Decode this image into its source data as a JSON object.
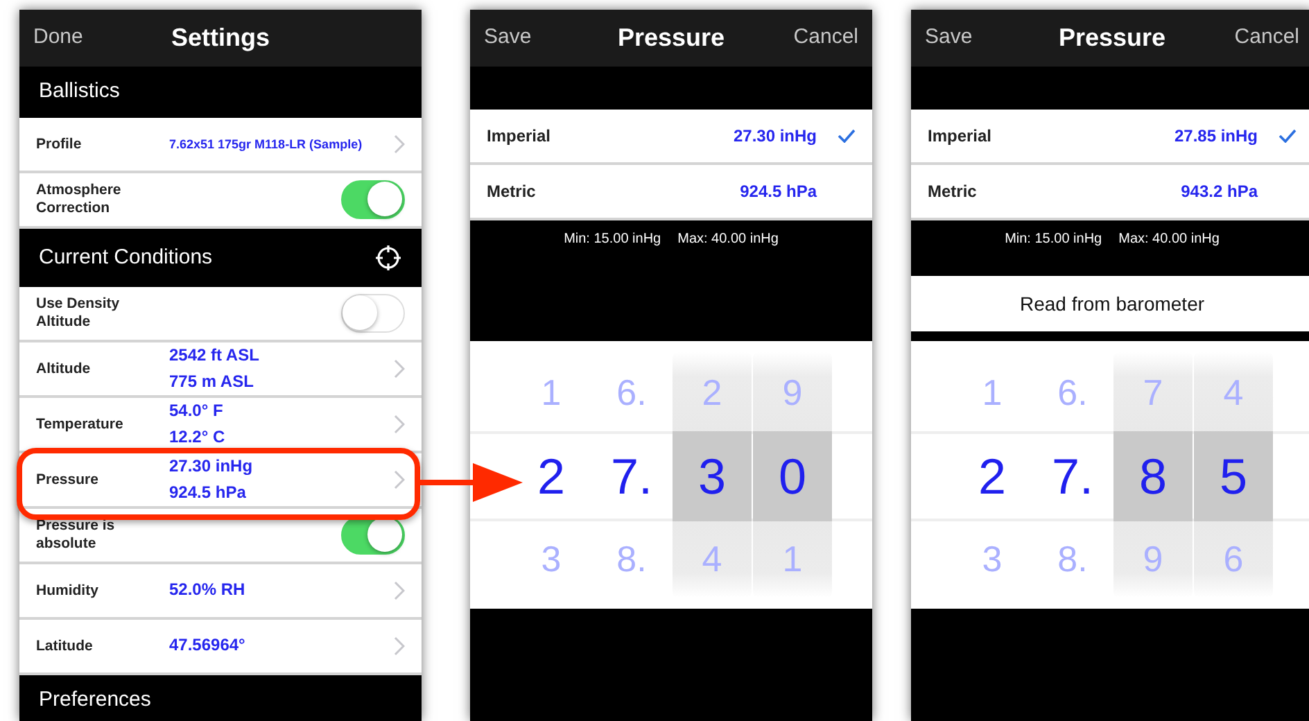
{
  "screens": [
    {
      "kind": "settings",
      "nav": {
        "left": "Done",
        "title": "Settings"
      },
      "sections": [
        {
          "title": "Ballistics",
          "target_icon": false,
          "rows": [
            {
              "kind": "value",
              "label": "Profile",
              "values": [
                "7.62x51 175gr M118-LR (Sample)"
              ],
              "small": true
            },
            {
              "kind": "switch",
              "label": "Atmosphere Correction",
              "on": true
            }
          ]
        },
        {
          "title": "Current Conditions",
          "target_icon": true,
          "rows": [
            {
              "kind": "switch",
              "label": "Use Density Altitude",
              "on": false
            },
            {
              "kind": "value",
              "label": "Altitude",
              "values": [
                "2542 ft ASL",
                "775 m ASL"
              ]
            },
            {
              "kind": "value",
              "label": "Temperature",
              "values": [
                "54.0° F",
                "12.2° C"
              ]
            },
            {
              "kind": "value",
              "label": "Pressure",
              "values": [
                "27.30 inHg",
                "924.5 hPa"
              ]
            },
            {
              "kind": "switch",
              "label": "Pressure is absolute",
              "on": true
            },
            {
              "kind": "value",
              "label": "Humidity",
              "values": [
                "52.0% RH"
              ]
            },
            {
              "kind": "value",
              "label": "Latitude",
              "values": [
                "47.56964°"
              ]
            }
          ]
        },
        {
          "title": "Preferences",
          "target_icon": false
        }
      ]
    },
    {
      "kind": "unit_editor",
      "nav": {
        "left": "Save",
        "title": "Pressure",
        "right": "Cancel"
      },
      "units": [
        {
          "label": "Imperial",
          "value": "27.30 inHg",
          "selected": true
        },
        {
          "label": "Metric",
          "value": "924.5 hPa",
          "selected": false
        }
      ],
      "limits": [
        "Min: 15.00 inHg",
        "Max: 40.00 inHg"
      ],
      "picker": [
        {
          "above": "1",
          "current": "2",
          "below": "3",
          "drum": false
        },
        {
          "above": "6.",
          "current": "7.",
          "below": "8.",
          "drum": false
        },
        {
          "above": "2",
          "current": "3",
          "below": "4",
          "drum": true
        },
        {
          "above": "9",
          "current": "0",
          "below": "1",
          "drum": true
        }
      ]
    },
    {
      "kind": "unit_editor",
      "nav": {
        "left": "Save",
        "title": "Pressure",
        "right": "Cancel"
      },
      "units": [
        {
          "label": "Imperial",
          "value": "27.85 inHg",
          "selected": true
        },
        {
          "label": "Metric",
          "value": "943.2 hPa",
          "selected": false
        }
      ],
      "limits": [
        "Min: 15.00 inHg",
        "Max: 40.00 inHg"
      ],
      "button": "Read from barometer",
      "picker": [
        {
          "above": "1",
          "current": "2",
          "below": "3",
          "drum": false
        },
        {
          "above": "6.",
          "current": "7.",
          "below": "8.",
          "drum": false
        },
        {
          "above": "7",
          "current": "8",
          "below": "9",
          "drum": true
        },
        {
          "above": "4",
          "current": "5",
          "below": "6",
          "drum": true
        }
      ]
    }
  ],
  "callout": {
    "show": true
  }
}
